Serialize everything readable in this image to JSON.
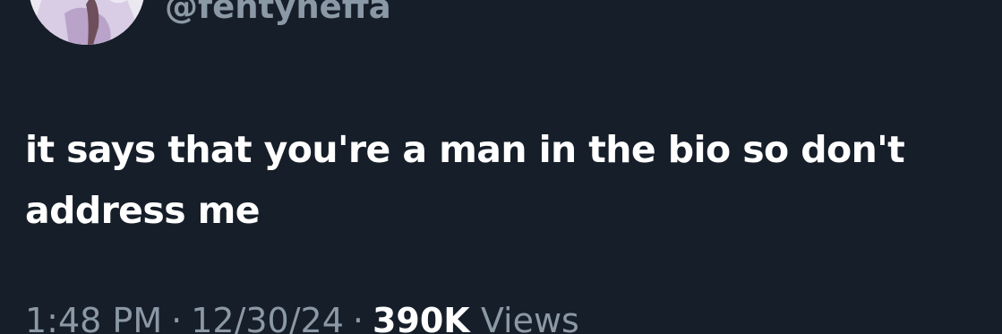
{
  "tweet": {
    "handle": "@fentyheffa",
    "text": "it says that you're a man in the bio so don't address me",
    "time": "1:48 PM",
    "separator": "·",
    "date": "12/30/24",
    "views_count": "390K",
    "views_label": "Views"
  },
  "colors": {
    "background": "#161e29",
    "primary_text": "#ffffff",
    "secondary_text": "#8b98a5"
  }
}
